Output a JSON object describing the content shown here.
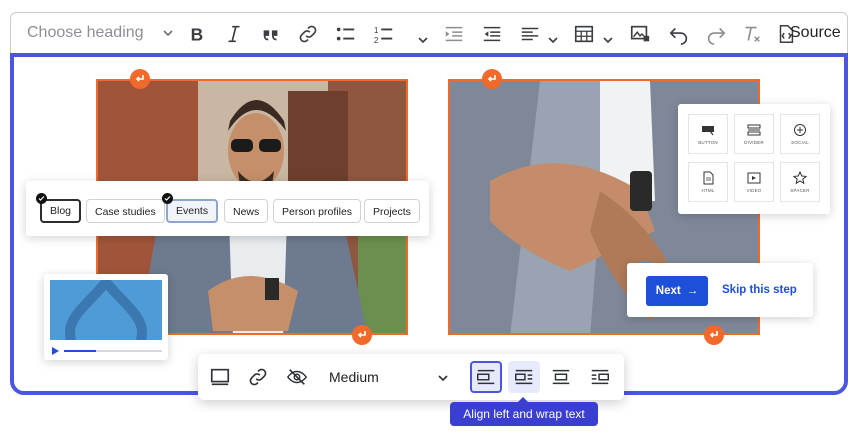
{
  "toolbar": {
    "heading_placeholder": "Choose heading",
    "source_label": "Source",
    "icons": [
      "bold-icon",
      "italic-icon",
      "blockquote-icon",
      "link-icon",
      "bulleted-list-icon",
      "numbered-list-icon",
      "indent-icon",
      "outdent-icon",
      "align-icon",
      "table-icon",
      "image-icon",
      "undo-icon",
      "redo-icon",
      "remove-format-icon",
      "source-icon"
    ]
  },
  "tags": {
    "items": [
      {
        "label": "Blog",
        "state": "selected"
      },
      {
        "label": "Case studies",
        "state": "default"
      },
      {
        "label": "Events",
        "state": "selected-light"
      },
      {
        "label": "News",
        "state": "default"
      },
      {
        "label": "Person profiles",
        "state": "default"
      },
      {
        "label": "Projects",
        "state": "default"
      }
    ]
  },
  "widgets": {
    "items": [
      "BUTTON",
      "DIVIDER",
      "SOCIAL",
      "HTML",
      "VIDEO",
      "SPACER"
    ]
  },
  "onboarding": {
    "next_label": "Next",
    "next_arrow": "→",
    "skip_label": "Skip this step"
  },
  "image_toolbar": {
    "size_value": "Medium",
    "tooltip": "Align left and wrap text",
    "buttons": [
      "alt-text-icon",
      "link-icon",
      "toggle-caption-icon",
      "align-left-icon",
      "align-left-wrap-icon",
      "align-center-icon",
      "align-right-wrap-icon"
    ]
  },
  "colors": {
    "accent": "#4b56e0",
    "image_border": "#f06a2c",
    "primary_button": "#1e4fd8",
    "tooltip_bg": "#3b3fd1"
  }
}
